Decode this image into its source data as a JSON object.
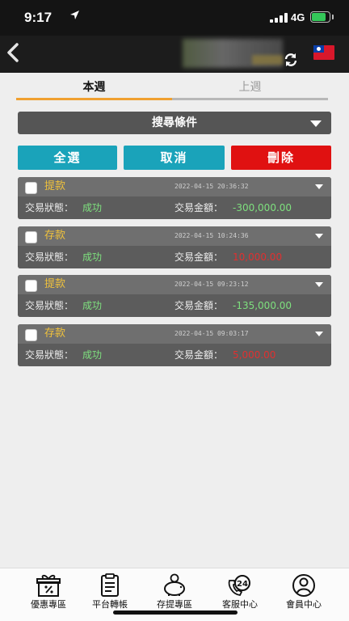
{
  "status_bar": {
    "time": "9:17",
    "network": "4G"
  },
  "tabs": [
    {
      "label": "本週"
    },
    {
      "label": "上週"
    }
  ],
  "search": {
    "label": "搜尋條件"
  },
  "actions": {
    "select_all": "全選",
    "cancel": "取消",
    "delete": "刪除"
  },
  "labels": {
    "status": "交易狀態：",
    "amount": "交易金額："
  },
  "records": [
    {
      "type": "提款",
      "time": "2022-04-15 20:36:32",
      "status": "成功",
      "amount": "-300,000.00",
      "amount_color": "#7ee07e"
    },
    {
      "type": "存款",
      "time": "2022-04-15 10:24:36",
      "status": "成功",
      "amount": "10,000.00",
      "amount_color": "#e03030"
    },
    {
      "type": "提款",
      "time": "2022-04-15 09:23:12",
      "status": "成功",
      "amount": "-135,000.00",
      "amount_color": "#7ee07e"
    },
    {
      "type": "存款",
      "time": "2022-04-15 09:03:17",
      "status": "成功",
      "amount": "5,000.00",
      "amount_color": "#e03030"
    }
  ],
  "bottom_nav": [
    {
      "label": "優惠專區",
      "icon": "gift-icon"
    },
    {
      "label": "平台轉帳",
      "icon": "clipboard-icon"
    },
    {
      "label": "存提專區",
      "icon": "piggy-bank-icon"
    },
    {
      "label": "客服中心",
      "icon": "support-24-icon"
    },
    {
      "label": "會員中心",
      "icon": "user-icon"
    }
  ],
  "colors": {
    "accent_teal": "#1aa3ba",
    "danger_red": "#e01111",
    "tab_underline": "#f0a030",
    "type_yellow": "#f0c23c",
    "success_green": "#7ee07e"
  }
}
